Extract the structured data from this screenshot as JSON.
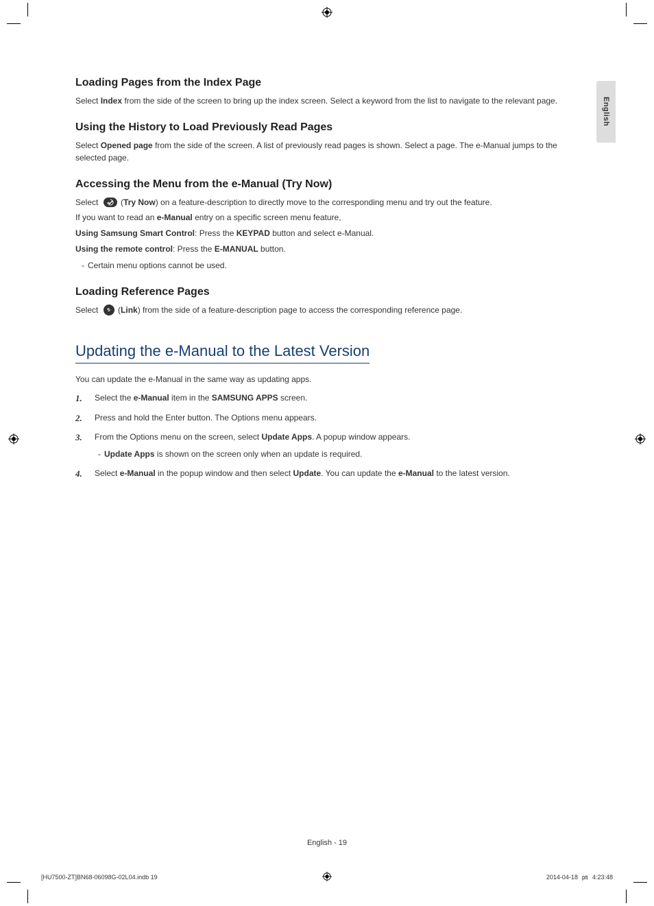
{
  "lang_tab": "English",
  "sections": {
    "s1": {
      "heading": "Loading Pages from the Index Page",
      "p1_a": "Select ",
      "p1_b": "Index",
      "p1_c": " from the side of the screen to bring up the index screen. Select a keyword from the list to navigate to the relevant page."
    },
    "s2": {
      "heading": "Using the History to Load Previously Read Pages",
      "p1_a": "Select ",
      "p1_b": "Opened page",
      "p1_c": " from the side of the screen. A list of previously read pages is shown. Select a page. The e-Manual jumps to the selected page."
    },
    "s3": {
      "heading": "Accessing the Menu from the e-Manual (Try Now)",
      "p1_a": "Select ",
      "p1_b": "Try Now",
      "p1_c": ") on a feature-description to directly move to the corresponding menu and try out the feature.",
      "p2_a": "If you want to read an ",
      "p2_b": "e-Manual",
      "p2_c": " entry on a specific screen menu feature,",
      "p3_a": "Using Samsung Smart Control",
      "p3_b": ": Press the ",
      "p3_c": "KEYPAD",
      "p3_d": " button and select e-Manual.",
      "p4_a": "Using the remote control",
      "p4_b": ": Press the ",
      "p4_c": "E-MANUAL",
      "p4_d": " button.",
      "note1": "Certain menu options cannot be used."
    },
    "s4": {
      "heading": "Loading Reference Pages",
      "p1_a": "Select ",
      "p1_b": "Link",
      "p1_c": ") from the side of a feature-description page to access the corresponding reference page."
    }
  },
  "title2": "Updating the e-Manual to the Latest Version",
  "update": {
    "intro": "You can update the e-Manual in the same way as updating apps.",
    "step1_a": "Select the ",
    "step1_b": "e-Manual",
    "step1_c": " item in the ",
    "step1_d": "SAMSUNG APPS",
    "step1_e": " screen.",
    "step2": "Press and hold the Enter button. The Options menu appears.",
    "step3_a": "From the Options menu on the screen, select ",
    "step3_b": "Update Apps",
    "step3_c": ". A popup window appears.",
    "step3_note_a": "Update Apps",
    "step3_note_b": " is shown on the screen only when an update is required.",
    "step4_a": "Select ",
    "step4_b": "e-Manual",
    "step4_c": " in the popup window and then select ",
    "step4_d": "Update",
    "step4_e": ". You can update the ",
    "step4_f": "e-Manual",
    "step4_g": " to the latest version."
  },
  "footer": {
    "page_label": "English - 19",
    "file": "[HU7500-ZT]BN68-06098G-02L04.indb   19",
    "date": "2014-04-18",
    "time": "4:23:48",
    "ampm_glyph": "㏘"
  }
}
